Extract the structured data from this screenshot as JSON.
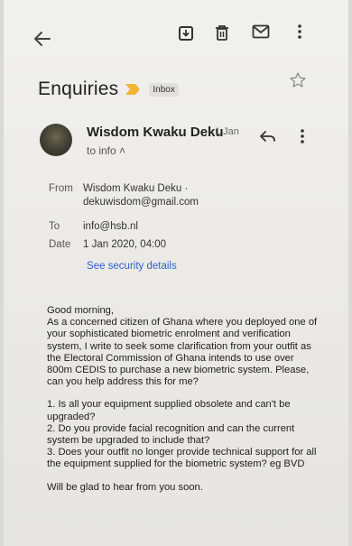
{
  "toolbar": {
    "back_icon": "arrow-back-icon",
    "archive_icon": "archive-icon",
    "delete_icon": "trash-icon",
    "mark_unread_icon": "mail-icon",
    "more_icon": "more-vert-icon"
  },
  "email": {
    "subject": "Enquiries",
    "label": "Inbox",
    "sender_name": "Wisdom Kwaku Deku",
    "date_short": "1 Jan",
    "to_line": "to info",
    "details": {
      "from_label": "From",
      "from_name": "Wisdom Kwaku Deku ·",
      "from_email": "dekuwisdom@gmail.com",
      "to_label": "To",
      "to_value": "info@hsb.nl",
      "date_label": "Date",
      "date_value": "1 Jan 2020, 04:00",
      "security_link": "See security details"
    },
    "body": {
      "greeting": "Good morning,",
      "paragraph1": "As a concerned citizen of Ghana where you deployed one of your sophisticated biometric enrolment and verification system, I write to seek some clarification from your outfit as the Electoral Commission of Ghana intends to use over 800m CEDIS to purchase a new biometric system. Please, can you help address this for me?",
      "questions": "1. Is all your equipment supplied obsolete and can't be upgraded?\n2. Do you provide facial recognition and can the current system be upgraded to include that?\n3. Does your outfit no longer provide technical support for all the equipment supplied for the biometric system? eg BVD",
      "closing": "Will be glad to hear from you soon."
    }
  },
  "colors": {
    "link": "#2f62c9",
    "important": "#f2b533"
  }
}
